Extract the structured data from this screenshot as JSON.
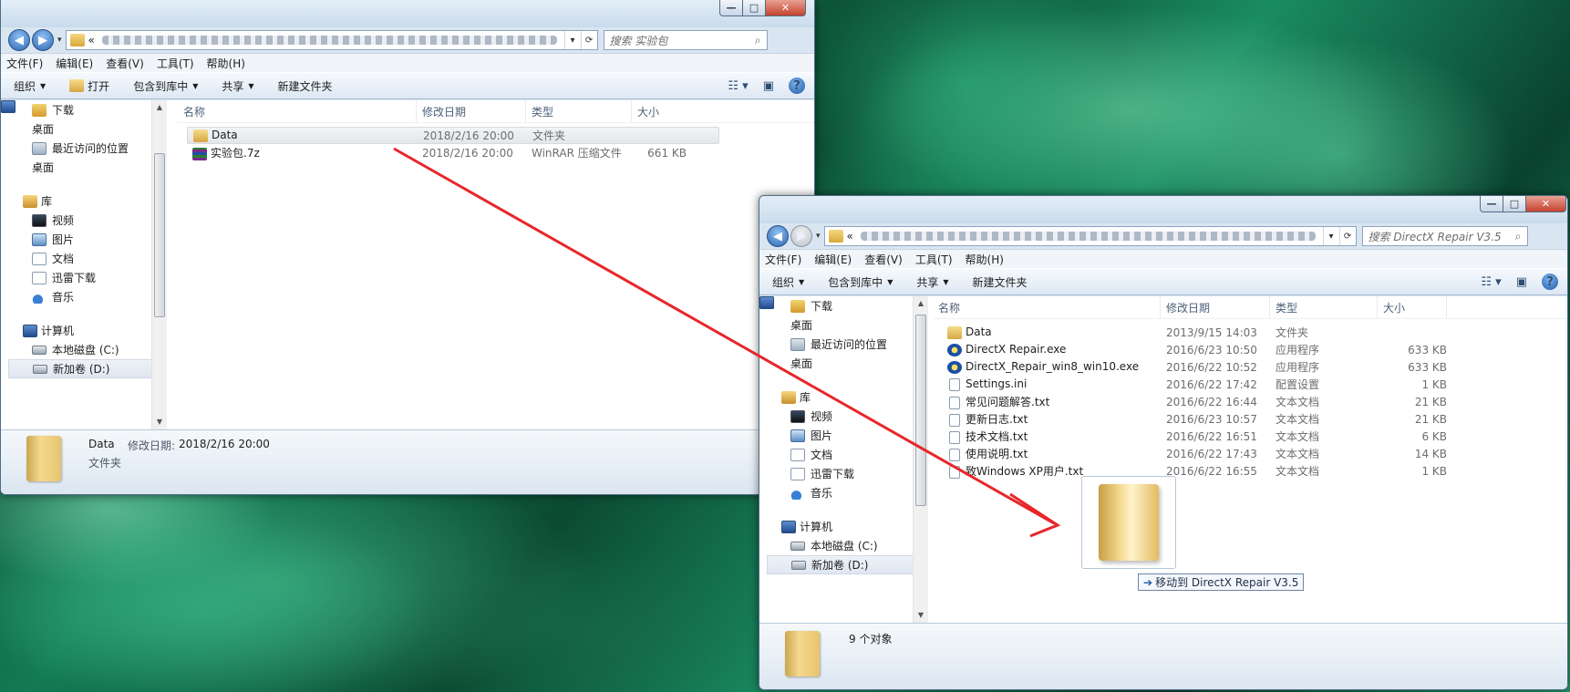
{
  "w1": {
    "search_placeholder": "搜索 实验包",
    "address_prefix": "«",
    "menu": [
      "文件(F)",
      "编辑(E)",
      "查看(V)",
      "工具(T)",
      "帮助(H)"
    ],
    "toolbar": {
      "organize": "组织",
      "open": "打开",
      "include": "包含到库中",
      "share": "共享",
      "newfolder": "新建文件夹"
    },
    "nav": {
      "fav": [
        "下载",
        "桌面",
        "最近访问的位置",
        "桌面"
      ],
      "lib_label": "库",
      "lib": [
        "视频",
        "图片",
        "文档",
        "迅雷下载",
        "音乐"
      ],
      "pc_label": "计算机",
      "disks": [
        "本地磁盘 (C:)",
        "新加卷 (D:)"
      ]
    },
    "columns": {
      "name": "名称",
      "date": "修改日期",
      "type": "类型",
      "size": "大小"
    },
    "files": [
      {
        "icon": "folder-icon",
        "name": "Data",
        "date": "2018/2/16 20:00",
        "type": "文件夹",
        "size": ""
      },
      {
        "icon": "archive-icon",
        "name": "实验包.7z",
        "date": "2018/2/16 20:00",
        "type": "WinRAR 压缩文件",
        "size": "661 KB"
      }
    ],
    "details": {
      "name": "Data",
      "date_label": "修改日期:",
      "date": "2018/2/16 20:00",
      "type": "文件夹"
    }
  },
  "w2": {
    "search_placeholder": "搜索 DirectX Repair V3.5",
    "address_prefix": "«",
    "menu": [
      "文件(F)",
      "编辑(E)",
      "查看(V)",
      "工具(T)",
      "帮助(H)"
    ],
    "toolbar": {
      "organize": "组织",
      "include": "包含到库中",
      "share": "共享",
      "newfolder": "新建文件夹"
    },
    "nav": {
      "fav": [
        "下载",
        "桌面",
        "最近访问的位置",
        "桌面"
      ],
      "lib_label": "库",
      "lib": [
        "视频",
        "图片",
        "文档",
        "迅雷下载",
        "音乐"
      ],
      "pc_label": "计算机",
      "disks": [
        "本地磁盘 (C:)",
        "新加卷 (D:)"
      ]
    },
    "columns": {
      "name": "名称",
      "date": "修改日期",
      "type": "类型",
      "size": "大小"
    },
    "files": [
      {
        "icon": "folder-icon",
        "name": "Data",
        "date": "2013/9/15 14:03",
        "type": "文件夹",
        "size": ""
      },
      {
        "icon": "exe-icon",
        "name": "DirectX Repair.exe",
        "date": "2016/6/23 10:50",
        "type": "应用程序",
        "size": "633 KB"
      },
      {
        "icon": "exe-icon",
        "name": "DirectX_Repair_win8_win10.exe",
        "date": "2016/6/22 10:52",
        "type": "应用程序",
        "size": "633 KB"
      },
      {
        "icon": "ini-icon",
        "name": "Settings.ini",
        "date": "2016/6/22 17:42",
        "type": "配置设置",
        "size": "1 KB"
      },
      {
        "icon": "txt-icon",
        "name": "常见问题解答.txt",
        "date": "2016/6/22 16:44",
        "type": "文本文档",
        "size": "21 KB"
      },
      {
        "icon": "txt-icon",
        "name": "更新日志.txt",
        "date": "2016/6/23 10:57",
        "type": "文本文档",
        "size": "21 KB"
      },
      {
        "icon": "txt-icon",
        "name": "技术文档.txt",
        "date": "2016/6/22 16:51",
        "type": "文本文档",
        "size": "6 KB"
      },
      {
        "icon": "txt-icon",
        "name": "使用说明.txt",
        "date": "2016/6/22 17:43",
        "type": "文本文档",
        "size": "14 KB"
      },
      {
        "icon": "txt-icon",
        "name": "致Windows XP用户.txt",
        "date": "2016/6/22 16:55",
        "type": "文本文档",
        "size": "1 KB"
      }
    ],
    "status": "9 个对象"
  },
  "drag_tooltip": "移动到 DirectX Repair V3.5",
  "colors": {
    "arrow": "#e8262a",
    "accent": "#2d67b5"
  }
}
